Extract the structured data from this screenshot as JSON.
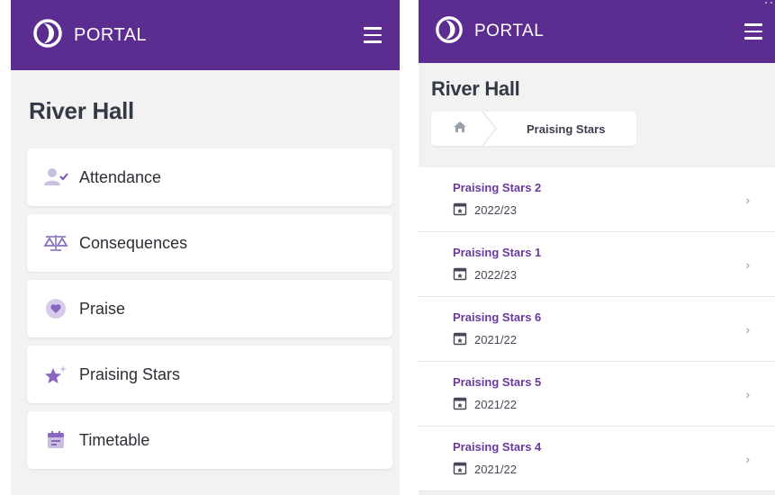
{
  "colors": {
    "brand": "#5b2d90",
    "accent_text": "#6a3a9c",
    "icon_tint": "#b9a6d6",
    "background": "#f2f2f3"
  },
  "left": {
    "header": {
      "brand": "PORTAL",
      "menu_icon": "hamburger-icon"
    },
    "title": "River Hall",
    "items": [
      {
        "label": "Attendance",
        "icon": "attendance-icon"
      },
      {
        "label": "Consequences",
        "icon": "scales-icon"
      },
      {
        "label": "Praise",
        "icon": "heart-icon"
      },
      {
        "label": "Praising Stars",
        "icon": "star-icon"
      },
      {
        "label": "Timetable",
        "icon": "calendar-icon"
      }
    ]
  },
  "right": {
    "header": {
      "brand": "PORTAL",
      "menu_icon": "hamburger-icon"
    },
    "title": "River Hall",
    "breadcrumb": {
      "home_icon": "home-icon",
      "current": "Praising Stars"
    },
    "records": [
      {
        "title": "Praising Stars 2",
        "year": "2022/23"
      },
      {
        "title": "Praising Stars 1",
        "year": "2022/23"
      },
      {
        "title": "Praising Stars 6",
        "year": "2021/22"
      },
      {
        "title": "Praising Stars 5",
        "year": "2021/22"
      },
      {
        "title": "Praising Stars 4",
        "year": "2021/22"
      }
    ]
  }
}
